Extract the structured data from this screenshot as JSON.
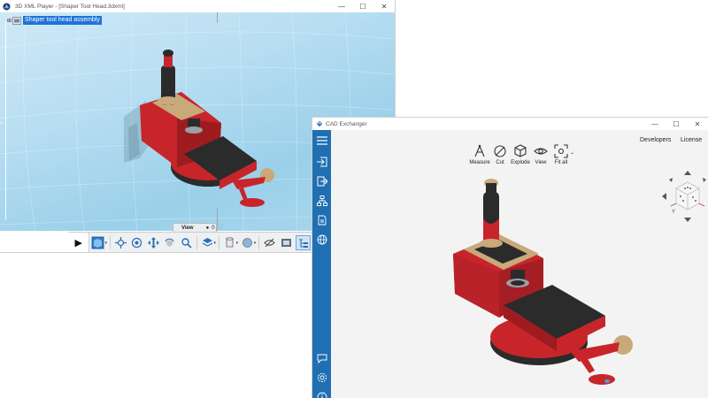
{
  "xml_player": {
    "title": "3D XML Player - [Shaper Tool Head.3dxml]",
    "window_controls": {
      "minimize": "—",
      "maximize": "☐",
      "close": "✕"
    },
    "tree": {
      "expander": "⊞",
      "root_label": "Shaper tool head assembly"
    },
    "view_panel": {
      "label": "View",
      "indicator": "●",
      "value": "0"
    },
    "toolbar": {
      "play": "▶",
      "icons": [
        "cube-view-icon",
        "explode-icon",
        "target-icon",
        "move-icon",
        "rotate-icon",
        "zoom-icon",
        "layers-icon",
        "cylinder-icon",
        "sphere-icon",
        "hide-icon",
        "screenshot-icon",
        "tree-view-icon"
      ]
    },
    "colors": {
      "viewport": "#a8d7ee",
      "selection": "#1e73d8"
    }
  },
  "cad_exchanger": {
    "title": "CAD Exchanger",
    "window_controls": {
      "minimize": "—",
      "maximize": "☐",
      "close": "✕"
    },
    "top_links": {
      "developers": "Developers",
      "license": "License"
    },
    "tools": [
      {
        "name": "measure",
        "label": "Measure"
      },
      {
        "name": "cut",
        "label": "Cut"
      },
      {
        "name": "explode",
        "label": "Explode"
      },
      {
        "name": "view",
        "label": "View"
      },
      {
        "name": "fit-all",
        "label": "Fit all"
      }
    ],
    "navcube": {
      "y_axis": "Y",
      "z_axis": "Z"
    },
    "sidebar_icons": [
      "menu-icon",
      "import-icon",
      "export-icon",
      "structure-icon",
      "convert-icon",
      "web-icon",
      "chat-icon",
      "settings-icon",
      "info-icon"
    ],
    "colors": {
      "sidebar": "#1f6fb2",
      "background": "#f3f3f3"
    }
  },
  "model_colors": {
    "red": "#c8252b",
    "dark": "#2b2b2b",
    "tan": "#c9a97a",
    "silver": "#9aa0a6"
  }
}
